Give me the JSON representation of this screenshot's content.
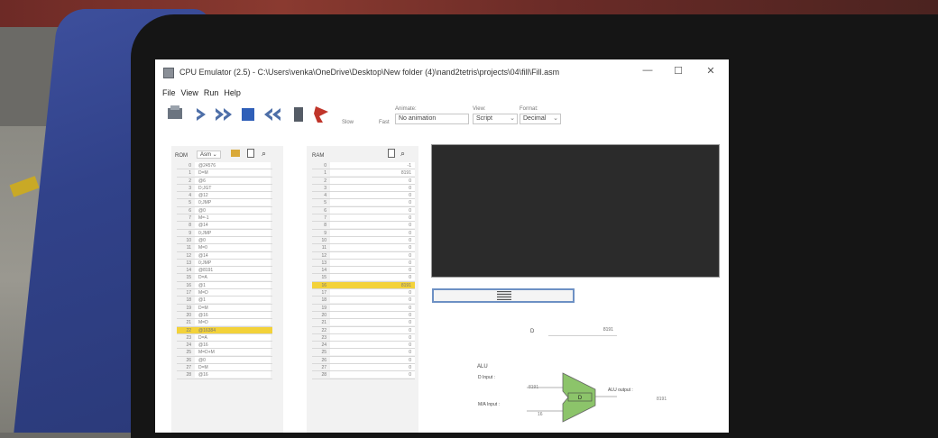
{
  "window": {
    "title": "CPU Emulator (2.5) - C:\\Users\\venka\\OneDrive\\Desktop\\New folder (4)\\nand2tetris\\projects\\04\\fill\\Fill.asm",
    "minimize": "—",
    "maximize": "☐",
    "close": "✕"
  },
  "menu": [
    "File",
    "View",
    "Run",
    "Help"
  ],
  "toolbar": {
    "slow_label": "Slow",
    "fast_label": "Fast",
    "animate_label": "Animate:",
    "animate_value": "No animation",
    "view_label": "View:",
    "view_value": "Script",
    "format_label": "Format:",
    "format_value": "Decimal"
  },
  "rom": {
    "label": "ROM",
    "mode": "Asm",
    "highlight_row": 22,
    "rows": [
      {
        "n": "0",
        "v": "@24576"
      },
      {
        "n": "1",
        "v": "D=M"
      },
      {
        "n": "2",
        "v": "@6"
      },
      {
        "n": "3",
        "v": "D;JGT"
      },
      {
        "n": "4",
        "v": "@12"
      },
      {
        "n": "5",
        "v": "0;JMP"
      },
      {
        "n": "6",
        "v": "@0"
      },
      {
        "n": "7",
        "v": "M=-1"
      },
      {
        "n": "8",
        "v": "@14"
      },
      {
        "n": "9",
        "v": "0;JMP"
      },
      {
        "n": "10",
        "v": "@0"
      },
      {
        "n": "11",
        "v": "M=0"
      },
      {
        "n": "12",
        "v": "@14"
      },
      {
        "n": "13",
        "v": "0;JMP"
      },
      {
        "n": "14",
        "v": "@8191"
      },
      {
        "n": "15",
        "v": "D=A"
      },
      {
        "n": "16",
        "v": "@1"
      },
      {
        "n": "17",
        "v": "M=D"
      },
      {
        "n": "18",
        "v": "@1"
      },
      {
        "n": "19",
        "v": "D=M"
      },
      {
        "n": "20",
        "v": "@16"
      },
      {
        "n": "21",
        "v": "M=D"
      },
      {
        "n": "22",
        "v": "@16384"
      },
      {
        "n": "23",
        "v": "D=A"
      },
      {
        "n": "24",
        "v": "@16"
      },
      {
        "n": "25",
        "v": "M=D+M"
      },
      {
        "n": "26",
        "v": "@0"
      },
      {
        "n": "27",
        "v": "D=M"
      },
      {
        "n": "28",
        "v": "@16"
      }
    ]
  },
  "ram": {
    "label": "RAM",
    "highlight_row": 16,
    "rows": [
      {
        "n": "0",
        "v": "-1"
      },
      {
        "n": "1",
        "v": "8191"
      },
      {
        "n": "2",
        "v": "0"
      },
      {
        "n": "3",
        "v": "0"
      },
      {
        "n": "4",
        "v": "0"
      },
      {
        "n": "5",
        "v": "0"
      },
      {
        "n": "6",
        "v": "0"
      },
      {
        "n": "7",
        "v": "0"
      },
      {
        "n": "8",
        "v": "0"
      },
      {
        "n": "9",
        "v": "0"
      },
      {
        "n": "10",
        "v": "0"
      },
      {
        "n": "11",
        "v": "0"
      },
      {
        "n": "12",
        "v": "0"
      },
      {
        "n": "13",
        "v": "0"
      },
      {
        "n": "14",
        "v": "0"
      },
      {
        "n": "15",
        "v": "0"
      },
      {
        "n": "16",
        "v": "8191"
      },
      {
        "n": "17",
        "v": "0"
      },
      {
        "n": "18",
        "v": "0"
      },
      {
        "n": "19",
        "v": "0"
      },
      {
        "n": "20",
        "v": "0"
      },
      {
        "n": "21",
        "v": "0"
      },
      {
        "n": "22",
        "v": "0"
      },
      {
        "n": "23",
        "v": "0"
      },
      {
        "n": "24",
        "v": "0"
      },
      {
        "n": "25",
        "v": "0"
      },
      {
        "n": "26",
        "v": "0"
      },
      {
        "n": "27",
        "v": "0"
      },
      {
        "n": "28",
        "v": "0"
      }
    ]
  },
  "registers": {
    "d_label": "D",
    "d_value": "8191"
  },
  "alu": {
    "label": "ALU",
    "d_input_label": "D Input :",
    "d_input_value": "8191",
    "ma_input_label": "M/A Input :",
    "ma_input_value": "16",
    "op": "D",
    "output_label": "ALU output :",
    "output_value": "8191"
  },
  "colors": {
    "highlight": "#f3d23a",
    "alu_fill": "#8cc46a",
    "screen_bg": "#2b2b2b",
    "toolbar_blue": "#5577aa"
  }
}
